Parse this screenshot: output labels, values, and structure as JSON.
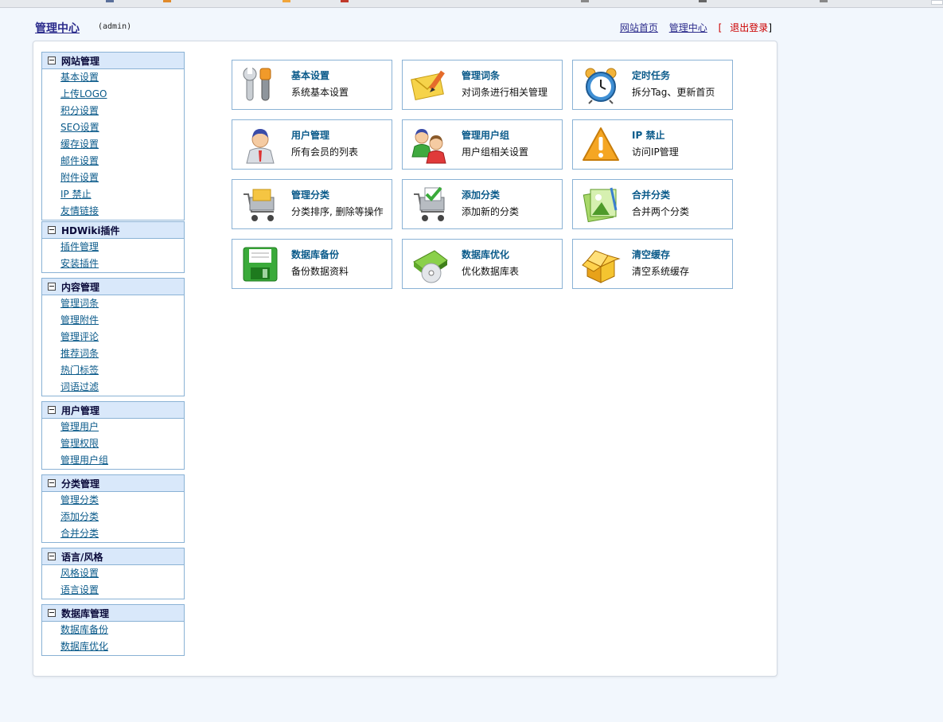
{
  "header": {
    "title": "管理中心",
    "user": "(admin)",
    "links": [
      "网站首页",
      "管理中心"
    ],
    "logout": "退出登录",
    "bracket_open": "[",
    "bracket_close": "]"
  },
  "sidebar": [
    {
      "title": "网站管理",
      "items": [
        "基本设置",
        "上传LOGO",
        "积分设置",
        "SEO设置",
        "缓存设置",
        "邮件设置",
        "附件设置",
        "IP 禁止",
        "友情链接"
      ]
    },
    {
      "title": "HDWiki插件",
      "items": [
        "插件管理",
        "安装插件"
      ]
    },
    {
      "title": "内容管理",
      "items": [
        "管理词条",
        "管理附件",
        "管理评论",
        "推荐词条",
        "热门标签",
        "词语过滤"
      ]
    },
    {
      "title": "用户管理",
      "items": [
        "管理用户",
        "管理权限",
        "管理用户组"
      ]
    },
    {
      "title": "分类管理",
      "items": [
        "管理分类",
        "添加分类",
        "合并分类"
      ]
    },
    {
      "title": "语言/风格",
      "items": [
        "风格设置",
        "语言设置"
      ]
    },
    {
      "title": "数据库管理",
      "items": [
        "数据库备份",
        "数据库优化"
      ]
    }
  ],
  "tiles": [
    {
      "title": "基本设置",
      "desc": "系统基本设置",
      "icon": "tools-icon"
    },
    {
      "title": "管理词条",
      "desc": "对词条进行相关管理",
      "icon": "envelope-pencil-icon"
    },
    {
      "title": "定时任务",
      "desc": "拆分Tag、更新首页",
      "icon": "alarm-clock-icon"
    },
    {
      "title": "用户管理",
      "desc": "所有会员的列表",
      "icon": "user-icon"
    },
    {
      "title": "管理用户组",
      "desc": "用户组相关设置",
      "icon": "users-group-icon"
    },
    {
      "title": "IP 禁止",
      "desc": "访问IP管理",
      "icon": "warning-icon"
    },
    {
      "title": "管理分类",
      "desc": "分类排序, 删除等操作",
      "icon": "cart-folder-icon"
    },
    {
      "title": "添加分类",
      "desc": "添加新的分类",
      "icon": "cart-add-icon"
    },
    {
      "title": "合并分类",
      "desc": "合并两个分类",
      "icon": "merge-image-icon"
    },
    {
      "title": "数据库备份",
      "desc": "备份数据资料",
      "icon": "floppy-disk-icon"
    },
    {
      "title": "数据库优化",
      "desc": "优化数据库表",
      "icon": "disc-icon"
    },
    {
      "title": "清空缓存",
      "desc": "清空系统缓存",
      "icon": "open-box-icon"
    }
  ],
  "colors": {
    "link": "#0a5a8a",
    "menu_header_bg": "#d9e8fa",
    "border": "#8ab2d5",
    "logout": "#cc0000",
    "page_bg": "#f2f7fd"
  }
}
